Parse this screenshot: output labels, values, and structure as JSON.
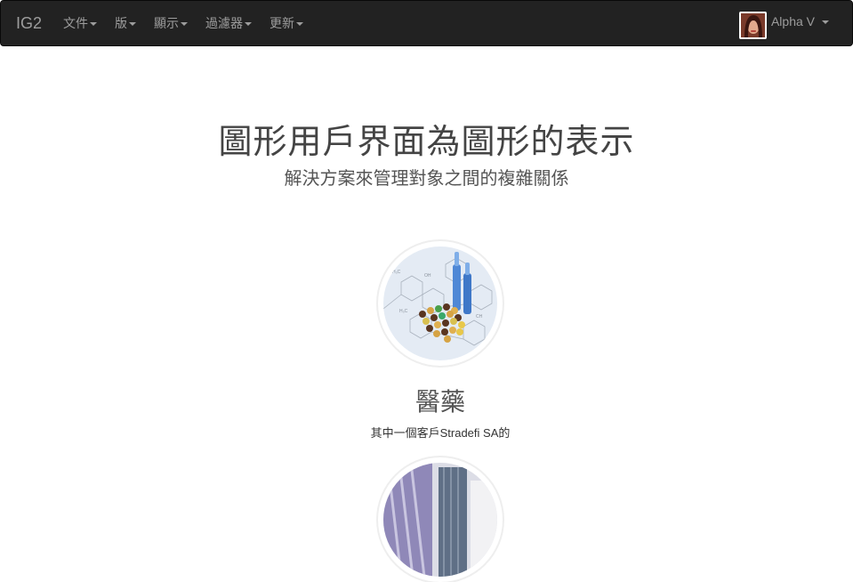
{
  "navbar": {
    "brand": "IG2",
    "menu": [
      {
        "label": "文件"
      },
      {
        "label": "版"
      },
      {
        "label": "顯示"
      },
      {
        "label": "過濾器"
      },
      {
        "label": "更新"
      }
    ],
    "user": {
      "name": "Alpha V"
    }
  },
  "hero": {
    "title": "圖形用戶界面為圖形的表示",
    "subtitle": "解決方案來管理對象之間的複雜關係"
  },
  "sections": [
    {
      "title": "醫藥",
      "description": "其中一個客戶Stradefi SA的",
      "icon": "pharma-pills-image"
    },
    {
      "icon": "building-image"
    }
  ]
}
